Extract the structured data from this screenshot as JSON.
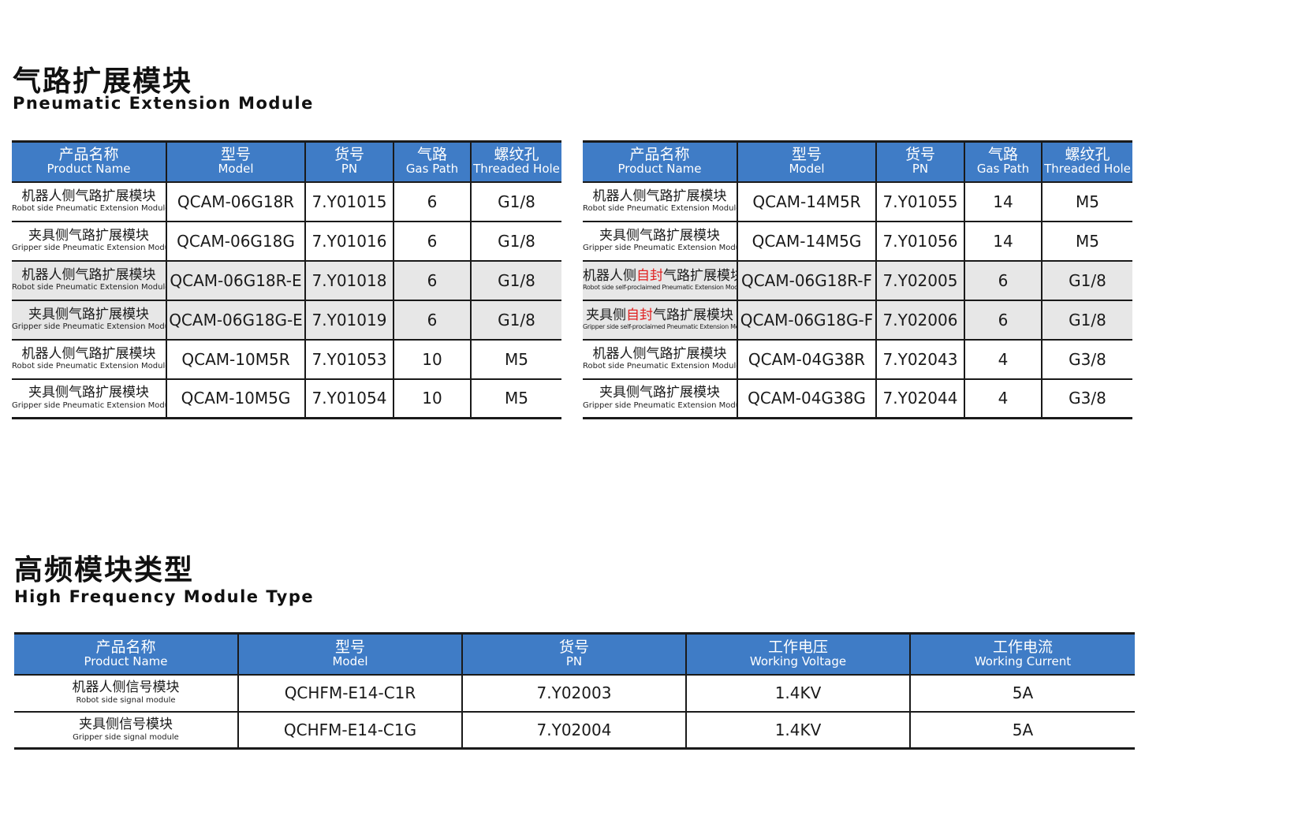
{
  "section1": {
    "title_zh": "气路扩展模块",
    "title_en": "Pneumatic Extension Module",
    "headers": [
      {
        "zh": "产品名称",
        "en": "Product Name"
      },
      {
        "zh": "型号",
        "en": "Model"
      },
      {
        "zh": "货号",
        "en": "PN"
      },
      {
        "zh": "气路",
        "en": "Gas Path"
      },
      {
        "zh": "螺纹孔",
        "en": "Threaded Hole"
      }
    ],
    "left_rows": [
      {
        "name_zh": "机器人侧气路扩展模块",
        "name_en": "Robot side Pneumatic Extension Module",
        "model": "QCAM-06G18R",
        "pn": "7.Y01015",
        "gas": "6",
        "thread": "G1/8"
      },
      {
        "name_zh": "夹具侧气路扩展模块",
        "name_en": "Gripper side Pneumatic Extension Module",
        "model": "QCAM-06G18G",
        "pn": "7.Y01016",
        "gas": "6",
        "thread": "G1/8"
      },
      {
        "name_zh": "机器人侧气路扩展模块",
        "name_en": "Robot side Pneumatic Extension Module",
        "model": "QCAM-06G18R-E",
        "pn": "7.Y01018",
        "gas": "6",
        "thread": "G1/8"
      },
      {
        "name_zh": "夹具侧气路扩展模块",
        "name_en": "Gripper side Pneumatic Extension Module",
        "model": "QCAM-06G18G-E",
        "pn": "7.Y01019",
        "gas": "6",
        "thread": "G1/8"
      },
      {
        "name_zh": "机器人侧气路扩展模块",
        "name_en": "Robot side Pneumatic Extension Module",
        "model": "QCAM-10M5R",
        "pn": "7.Y01053",
        "gas": "10",
        "thread": "M5"
      },
      {
        "name_zh": "夹具侧气路扩展模块",
        "name_en": "Gripper side Pneumatic Extension Module",
        "model": "QCAM-10M5G",
        "pn": "7.Y01054",
        "gas": "10",
        "thread": "M5"
      }
    ],
    "right_rows": [
      {
        "name_zh_a": "机器人侧气路扩展模块",
        "name_zh_red": "",
        "name_zh_b": "",
        "name_en": "Robot side Pneumatic Extension Module",
        "model": "QCAM-14M5R",
        "pn": "7.Y01055",
        "gas": "14",
        "thread": "M5"
      },
      {
        "name_zh_a": "夹具侧气路扩展模块",
        "name_zh_red": "",
        "name_zh_b": "",
        "name_en": "Gripper side Pneumatic Extension Module",
        "model": "QCAM-14M5G",
        "pn": "7.Y01056",
        "gas": "14",
        "thread": "M5"
      },
      {
        "name_zh_a": "机器人侧",
        "name_zh_red": "自封",
        "name_zh_b": "气路扩展模块",
        "name_en": "Robot side self-proclaimed  Pneumatic Extension Module",
        "model": "QCAM-06G18R-F",
        "pn": "7.Y02005",
        "gas": "6",
        "thread": "G1/8"
      },
      {
        "name_zh_a": "夹具侧",
        "name_zh_red": "自封",
        "name_zh_b": "气路扩展模块",
        "name_en": "Gripper side self-proclaimed Pneumatic Extension Module",
        "model": "QCAM-06G18G-F",
        "pn": "7.Y02006",
        "gas": "6",
        "thread": "G1/8"
      },
      {
        "name_zh_a": "机器人侧气路扩展模块",
        "name_zh_red": "",
        "name_zh_b": "",
        "name_en": "Robot side Pneumatic Extension Module",
        "model": "QCAM-04G38R",
        "pn": "7.Y02043",
        "gas": "4",
        "thread": "G3/8"
      },
      {
        "name_zh_a": "夹具侧气路扩展模块",
        "name_zh_red": "",
        "name_zh_b": "",
        "name_en": "Gripper side Pneumatic Extension Module",
        "model": "QCAM-04G38G",
        "pn": "7.Y02044",
        "gas": "4",
        "thread": "G3/8"
      }
    ]
  },
  "section2": {
    "title_zh": "高频模块类型",
    "title_en": "High Frequency Module Type",
    "headers": [
      {
        "zh": "产品名称",
        "en": "Product Name"
      },
      {
        "zh": "型号",
        "en": "Model"
      },
      {
        "zh": "货号",
        "en": "PN"
      },
      {
        "zh": "工作电压",
        "en": "Working Voltage"
      },
      {
        "zh": "工作电流",
        "en": "Working Current"
      }
    ],
    "rows": [
      {
        "name_zh": "机器人侧信号模块",
        "name_en": "Robot side signal module",
        "model": "QCHFM-E14-C1R",
        "pn": "7.Y02003",
        "voltage": "1.4KV",
        "current": "5A"
      },
      {
        "name_zh": "夹具侧信号模块",
        "name_en": "Gripper side signal module",
        "model": "QCHFM-E14-C1G",
        "pn": "7.Y02004",
        "voltage": "1.4KV",
        "current": "5A"
      }
    ]
  },
  "colors": {
    "header_blue": "#3f7cc6",
    "row_shade": "#e7e7e7",
    "highlight_red": "#e02020"
  }
}
